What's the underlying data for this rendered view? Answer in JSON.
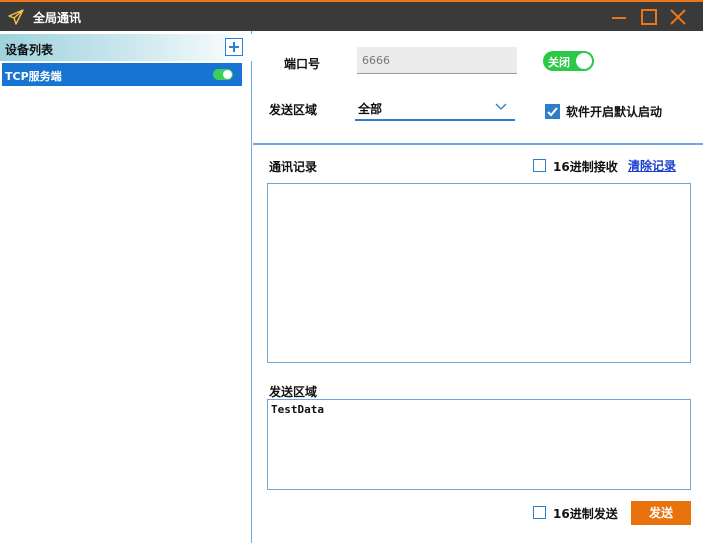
{
  "window": {
    "title": "全局通讯",
    "icons": {
      "app": "paper-plane-icon",
      "minimize": "minimize-icon",
      "maximize": "maximize-icon",
      "close": "close-icon"
    },
    "colors": {
      "titlebar": "#3a3a3a",
      "accent": "#e8761a",
      "primary": "#1874d2"
    }
  },
  "sidebar": {
    "title": "设备列表",
    "add_icon": "plus-icon",
    "items": [
      {
        "label": "TCP服务端",
        "enabled": true
      }
    ]
  },
  "settings": {
    "port_label": "端口号",
    "port_value": "6666",
    "server_switch_label": "关闭",
    "send_area_label": "发送区域",
    "send_area_selected": "全部",
    "autostart_label": "软件开启默认启动",
    "autostart_checked": true
  },
  "log": {
    "title": "通讯记录",
    "hex_receive_label": "16进制接收",
    "hex_receive_checked": false,
    "clear_link": "清除记录",
    "content": ""
  },
  "send": {
    "title": "发送区域",
    "content": "TestData",
    "hex_send_label": "16进制发送",
    "hex_send_checked": false,
    "send_button": "发送",
    "send_button_color": "#e8720c"
  }
}
